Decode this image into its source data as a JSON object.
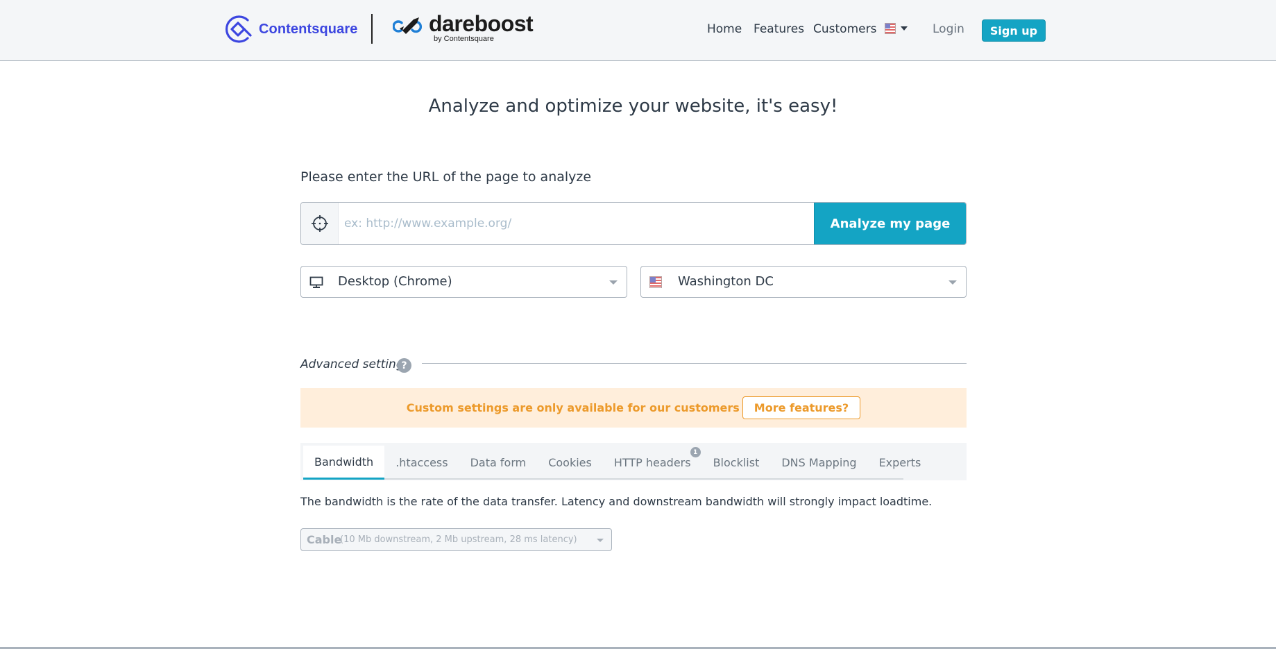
{
  "header": {
    "logo_contentsquare": "Contentsquare",
    "logo_dareboost": "dareboost",
    "logo_dareboost_tagline": "by Contentsquare",
    "nav": [
      {
        "label": "Home"
      },
      {
        "label": "Features"
      },
      {
        "label": "Customers"
      }
    ],
    "language": {
      "flag": "us-flag-icon",
      "selected": "English (US)"
    },
    "login_label": "Login",
    "signup_label": "Sign up"
  },
  "main": {
    "title": "Analyze and optimize your website, it's easy!",
    "url_label": "Please enter the URL of the page to analyze",
    "url_input": {
      "value": "",
      "placeholder": "ex: http://www.example.org/",
      "icon": "crosshair-icon"
    },
    "analyze_button": "Analyze my page",
    "device_select": {
      "value": "Desktop (Chrome)",
      "icon": "desktop-monitor-icon"
    },
    "location_select": {
      "value": "Washington DC",
      "icon": "us-flag-icon"
    },
    "advanced": {
      "label": "Advanced settings",
      "help_icon": "?",
      "notice": "Custom settings are only available for our customers",
      "more_features_button": "More features?"
    },
    "tabs": [
      {
        "label": "Bandwidth",
        "active": true
      },
      {
        "label": ".htaccess",
        "active": false
      },
      {
        "label": "Data form",
        "active": false
      },
      {
        "label": "Cookies",
        "active": false
      },
      {
        "label": "HTTP headers",
        "active": false,
        "badge": "1"
      },
      {
        "label": "Blocklist",
        "active": false
      },
      {
        "label": "DNS Mapping",
        "active": false
      },
      {
        "label": "Experts",
        "active": false
      }
    ],
    "bandwidth": {
      "description": "The bandwidth is the rate of the data transfer. Latency and downstream bandwidth will strongly impact loadtime.",
      "select_main": "Cable",
      "select_detail": "(10 Mb downstream, 2 Mb upstream, 28 ms latency)",
      "disabled": true
    }
  },
  "colors": {
    "brand_primary": "#14a4c4",
    "contentsquare_blue": "#3c46e0",
    "notice_bg": "#ffeedb",
    "notice_text": "#ec9a2b",
    "header_bg": "#f4f6f8",
    "text": "#2e3a47"
  }
}
